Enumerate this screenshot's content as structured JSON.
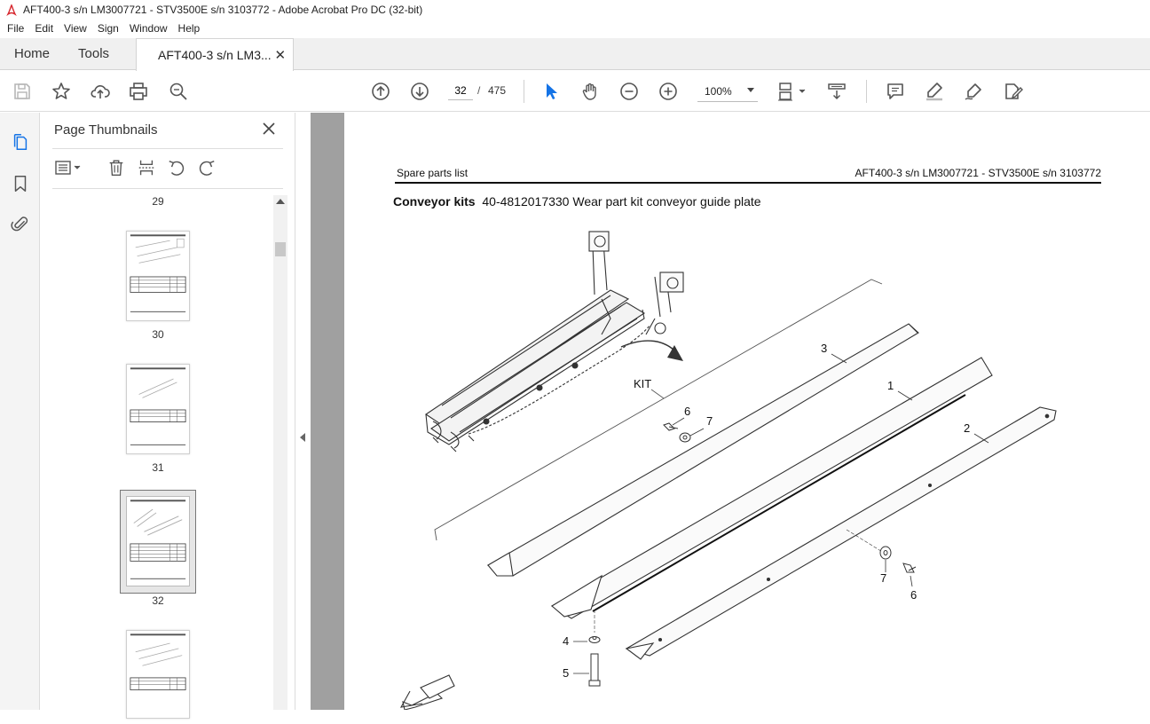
{
  "window": {
    "title": "AFT400-3  s/n LM3007721 - STV3500E s/n 3103772 - Adobe Acrobat Pro DC (32-bit)"
  },
  "menu": {
    "items": [
      "File",
      "Edit",
      "View",
      "Sign",
      "Window",
      "Help"
    ]
  },
  "tabs": {
    "home": "Home",
    "tools": "Tools",
    "document": "AFT400-3  s/n LM3...",
    "close_glyph": "✕"
  },
  "toolbar": {
    "current_page": "32",
    "page_separator": "/",
    "total_pages": "475",
    "zoom": "100%"
  },
  "thumbnails": {
    "panel_title": "Page Thumbnails",
    "pages": [
      "29",
      "30",
      "31",
      "32"
    ],
    "selected_page": "32"
  },
  "document": {
    "header_left": "Spare parts list",
    "header_right": "AFT400-3  s/n LM3007721 - STV3500E s/n 3103772",
    "section_bold": "Conveyor kits",
    "section_rest": "40-4812017330 Wear part kit conveyor guide plate",
    "callouts": {
      "kit": "KIT",
      "c1": "1",
      "c2": "2",
      "c3": "3",
      "c4": "4",
      "c5": "5",
      "c6a": "6",
      "c7a": "7",
      "c6b": "6",
      "c7b": "7"
    }
  },
  "colors": {
    "acrobat_red": "#d7282f",
    "select_blue": "#1473e6",
    "page_gray": "#a0a0a0"
  }
}
